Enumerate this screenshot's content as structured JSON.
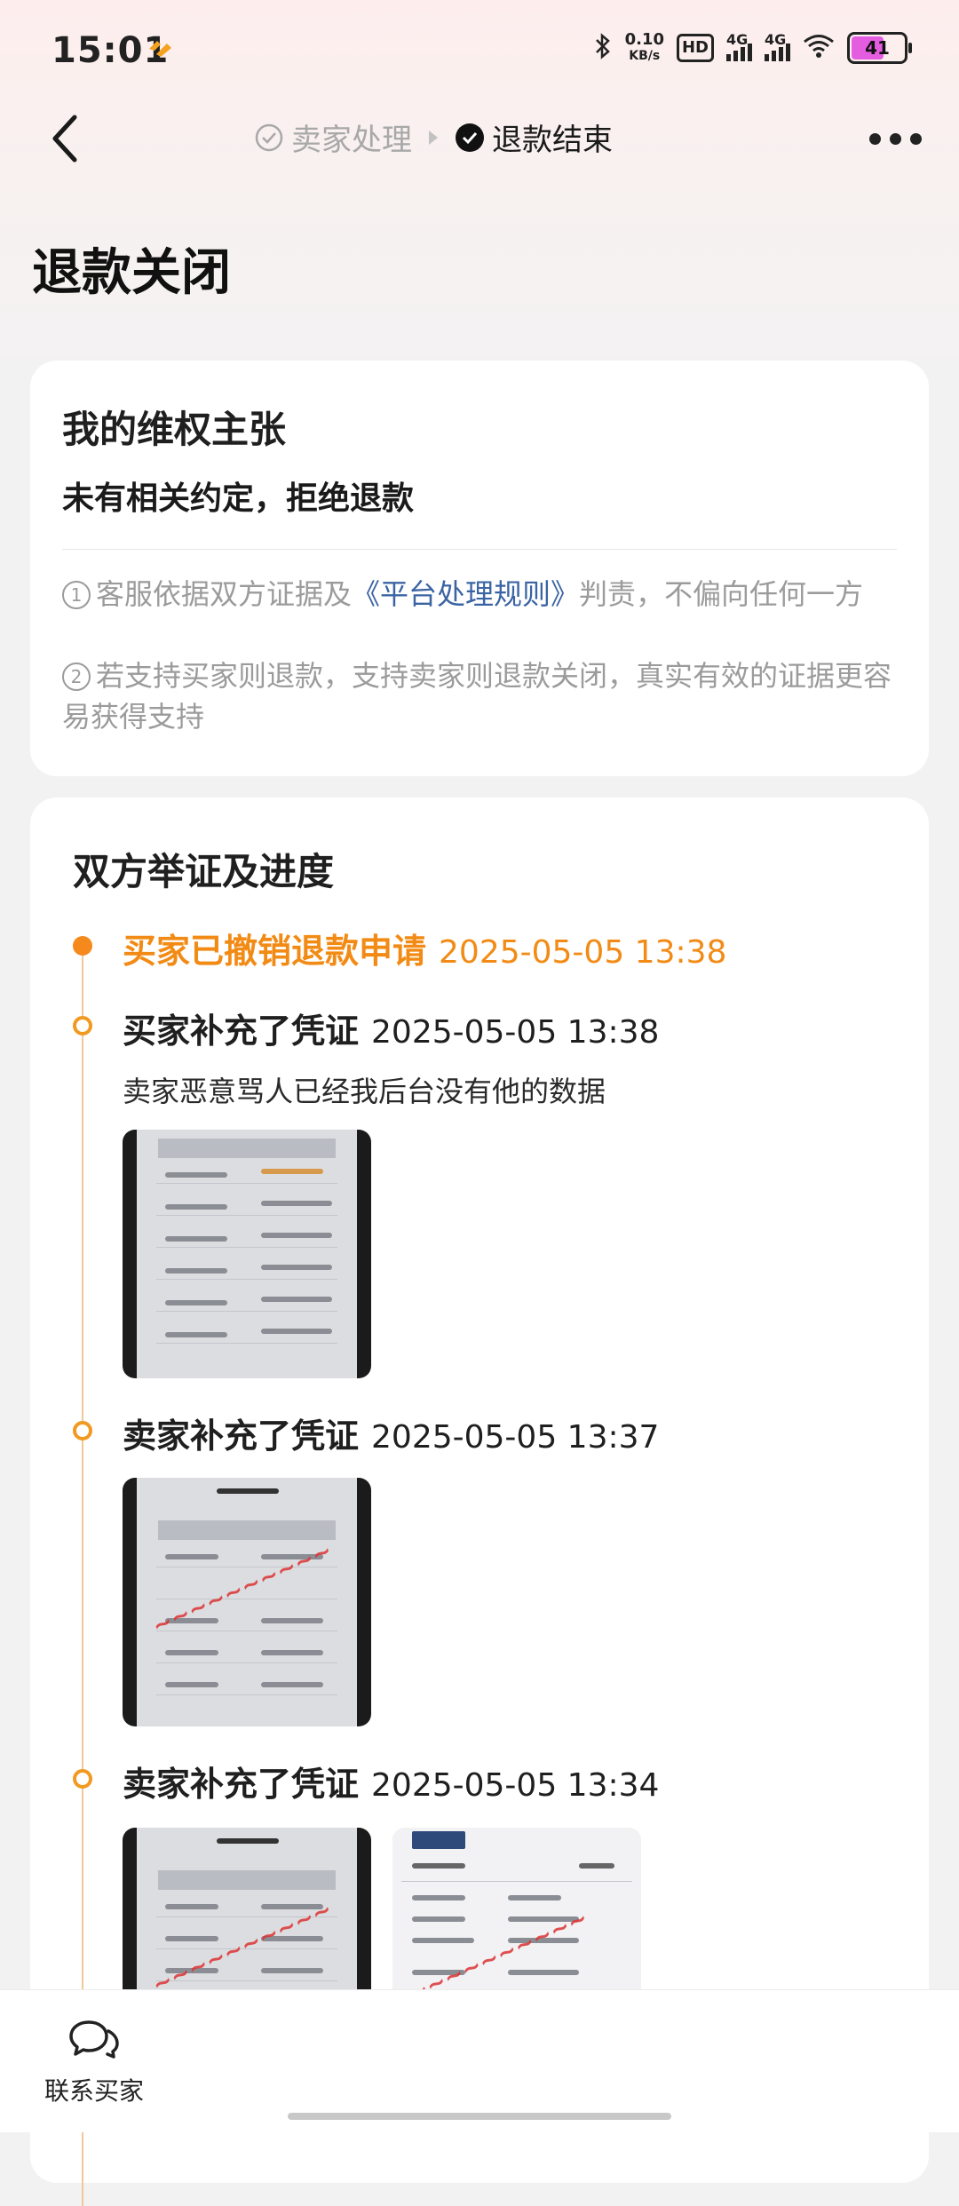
{
  "status_bar": {
    "time": "15:01",
    "net_speed_value": "0.10",
    "net_speed_unit": "KB/s",
    "hd_label": "HD",
    "hd_sub": "1",
    "hd_sub2": "2",
    "signal_label_1": "4G",
    "signal_label_2": "4G",
    "battery": "41",
    "icons": [
      "app-notify-icon",
      "bluetooth-icon",
      "hd-voice-icon",
      "signal-icon",
      "signal-icon",
      "wifi-icon",
      "battery-icon"
    ]
  },
  "header": {
    "back_icon": "chevron-left-icon",
    "step1_label": "卖家处理",
    "step2_label": "退款结束",
    "more_icon": "more-dots-icon"
  },
  "page": {
    "title": "退款关闭"
  },
  "claim": {
    "heading": "我的维权主张",
    "value": "未有相关约定，拒绝退款",
    "note1_num": "1",
    "note1_pre": "客服依据双方证据及",
    "note1_link": "《平台处理规则》",
    "note1_post": "判责，不偏向任何一方",
    "note2_num": "2",
    "note2_text": "若支持买家则退款，支持卖家则退款关闭，真实有效的证据更容易获得支持"
  },
  "progress": {
    "heading": "双方举证及进度",
    "entries": [
      {
        "title": "买家已撤销退款申请",
        "time": "2025-05-05 13:38"
      },
      {
        "title": "买家补充了凭证",
        "time": "2025-05-05 13:38",
        "desc": "卖家恶意骂人已经我后台没有他的数据"
      },
      {
        "title": "卖家补充了凭证",
        "time": "2025-05-05 13:37"
      },
      {
        "title": "卖家补充了凭证",
        "time": "2025-05-05 13:34"
      }
    ]
  },
  "bottom": {
    "contact_label": "联系买家",
    "contact_icon": "chat-bubbles-icon"
  }
}
